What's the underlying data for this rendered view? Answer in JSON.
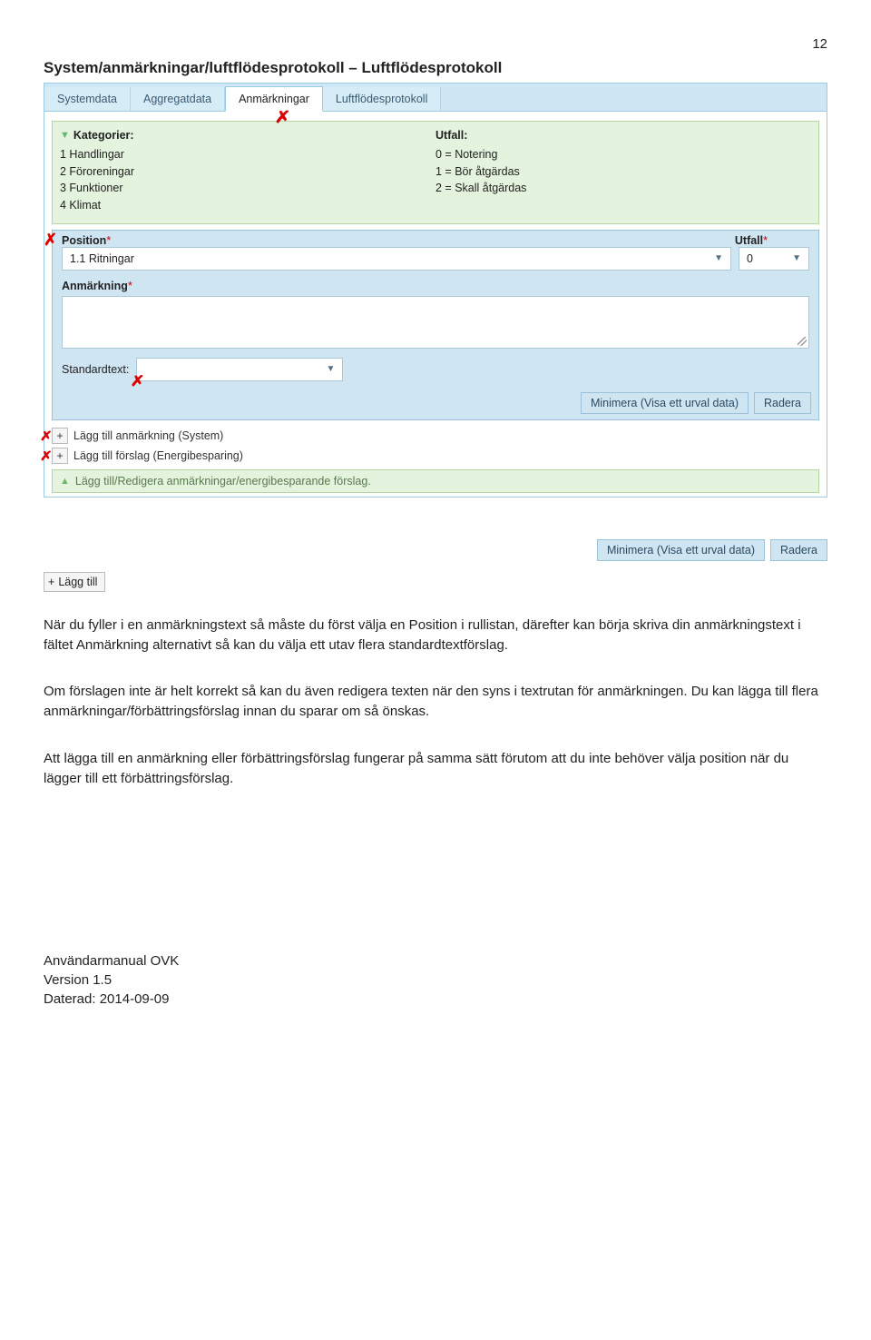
{
  "page_number": "12",
  "heading": "System/anmärkningar/luftflödesprotokoll – Luftflödesprotokoll",
  "tabs": [
    "Systemdata",
    "Aggregatdata",
    "Anmärkningar",
    "Luftflödesprotokoll"
  ],
  "active_tab_index": 2,
  "categories": {
    "header": "Kategorier:",
    "items": [
      "1 Handlingar",
      "2 Föroreningar",
      "3 Funktioner",
      "4 Klimat"
    ]
  },
  "utfall": {
    "header": "Utfall:",
    "items": [
      "0 = Notering",
      "1 = Bör åtgärdas",
      "2 = Skall åtgärdas"
    ]
  },
  "position_label": "Position",
  "position_value": "1.1 Ritningar",
  "utfall_label": "Utfall",
  "utfall_value": "0",
  "anmarkning_label": "Anmärkning",
  "standardtext_label": "Standardtext:",
  "buttons": {
    "minimera": "Minimera (Visa ett urval data)",
    "radera": "Radera"
  },
  "add_lines": [
    "Lägg till anmärkning (System)",
    "Lägg till förslag (Energibesparing)"
  ],
  "green_footer": "Lägg till/Redigera anmärkningar/energibesparande förslag.",
  "lagg_till": "Lägg till",
  "paragraphs": [
    "När du fyller i en anmärkningstext så måste du först välja en Position i rullistan, därefter kan börja skriva din anmärkningstext i fältet Anmärkning alternativt så kan du välja ett utav flera standardtextförslag.",
    "Om förslagen inte är helt korrekt så kan du även redigera texten när den syns i textrutan för anmärkningen. Du kan lägga till flera anmärkningar/förbättringsförslag innan du sparar om så önskas.",
    "Att lägga till en anmärkning eller förbättringsförslag fungerar på samma sätt förutom att du inte behöver välja position när du lägger till ett förbättringsförslag."
  ],
  "footer_lines": [
    "Användarmanual OVK",
    "Version 1.5",
    "Daterad: 2014-09-09"
  ]
}
